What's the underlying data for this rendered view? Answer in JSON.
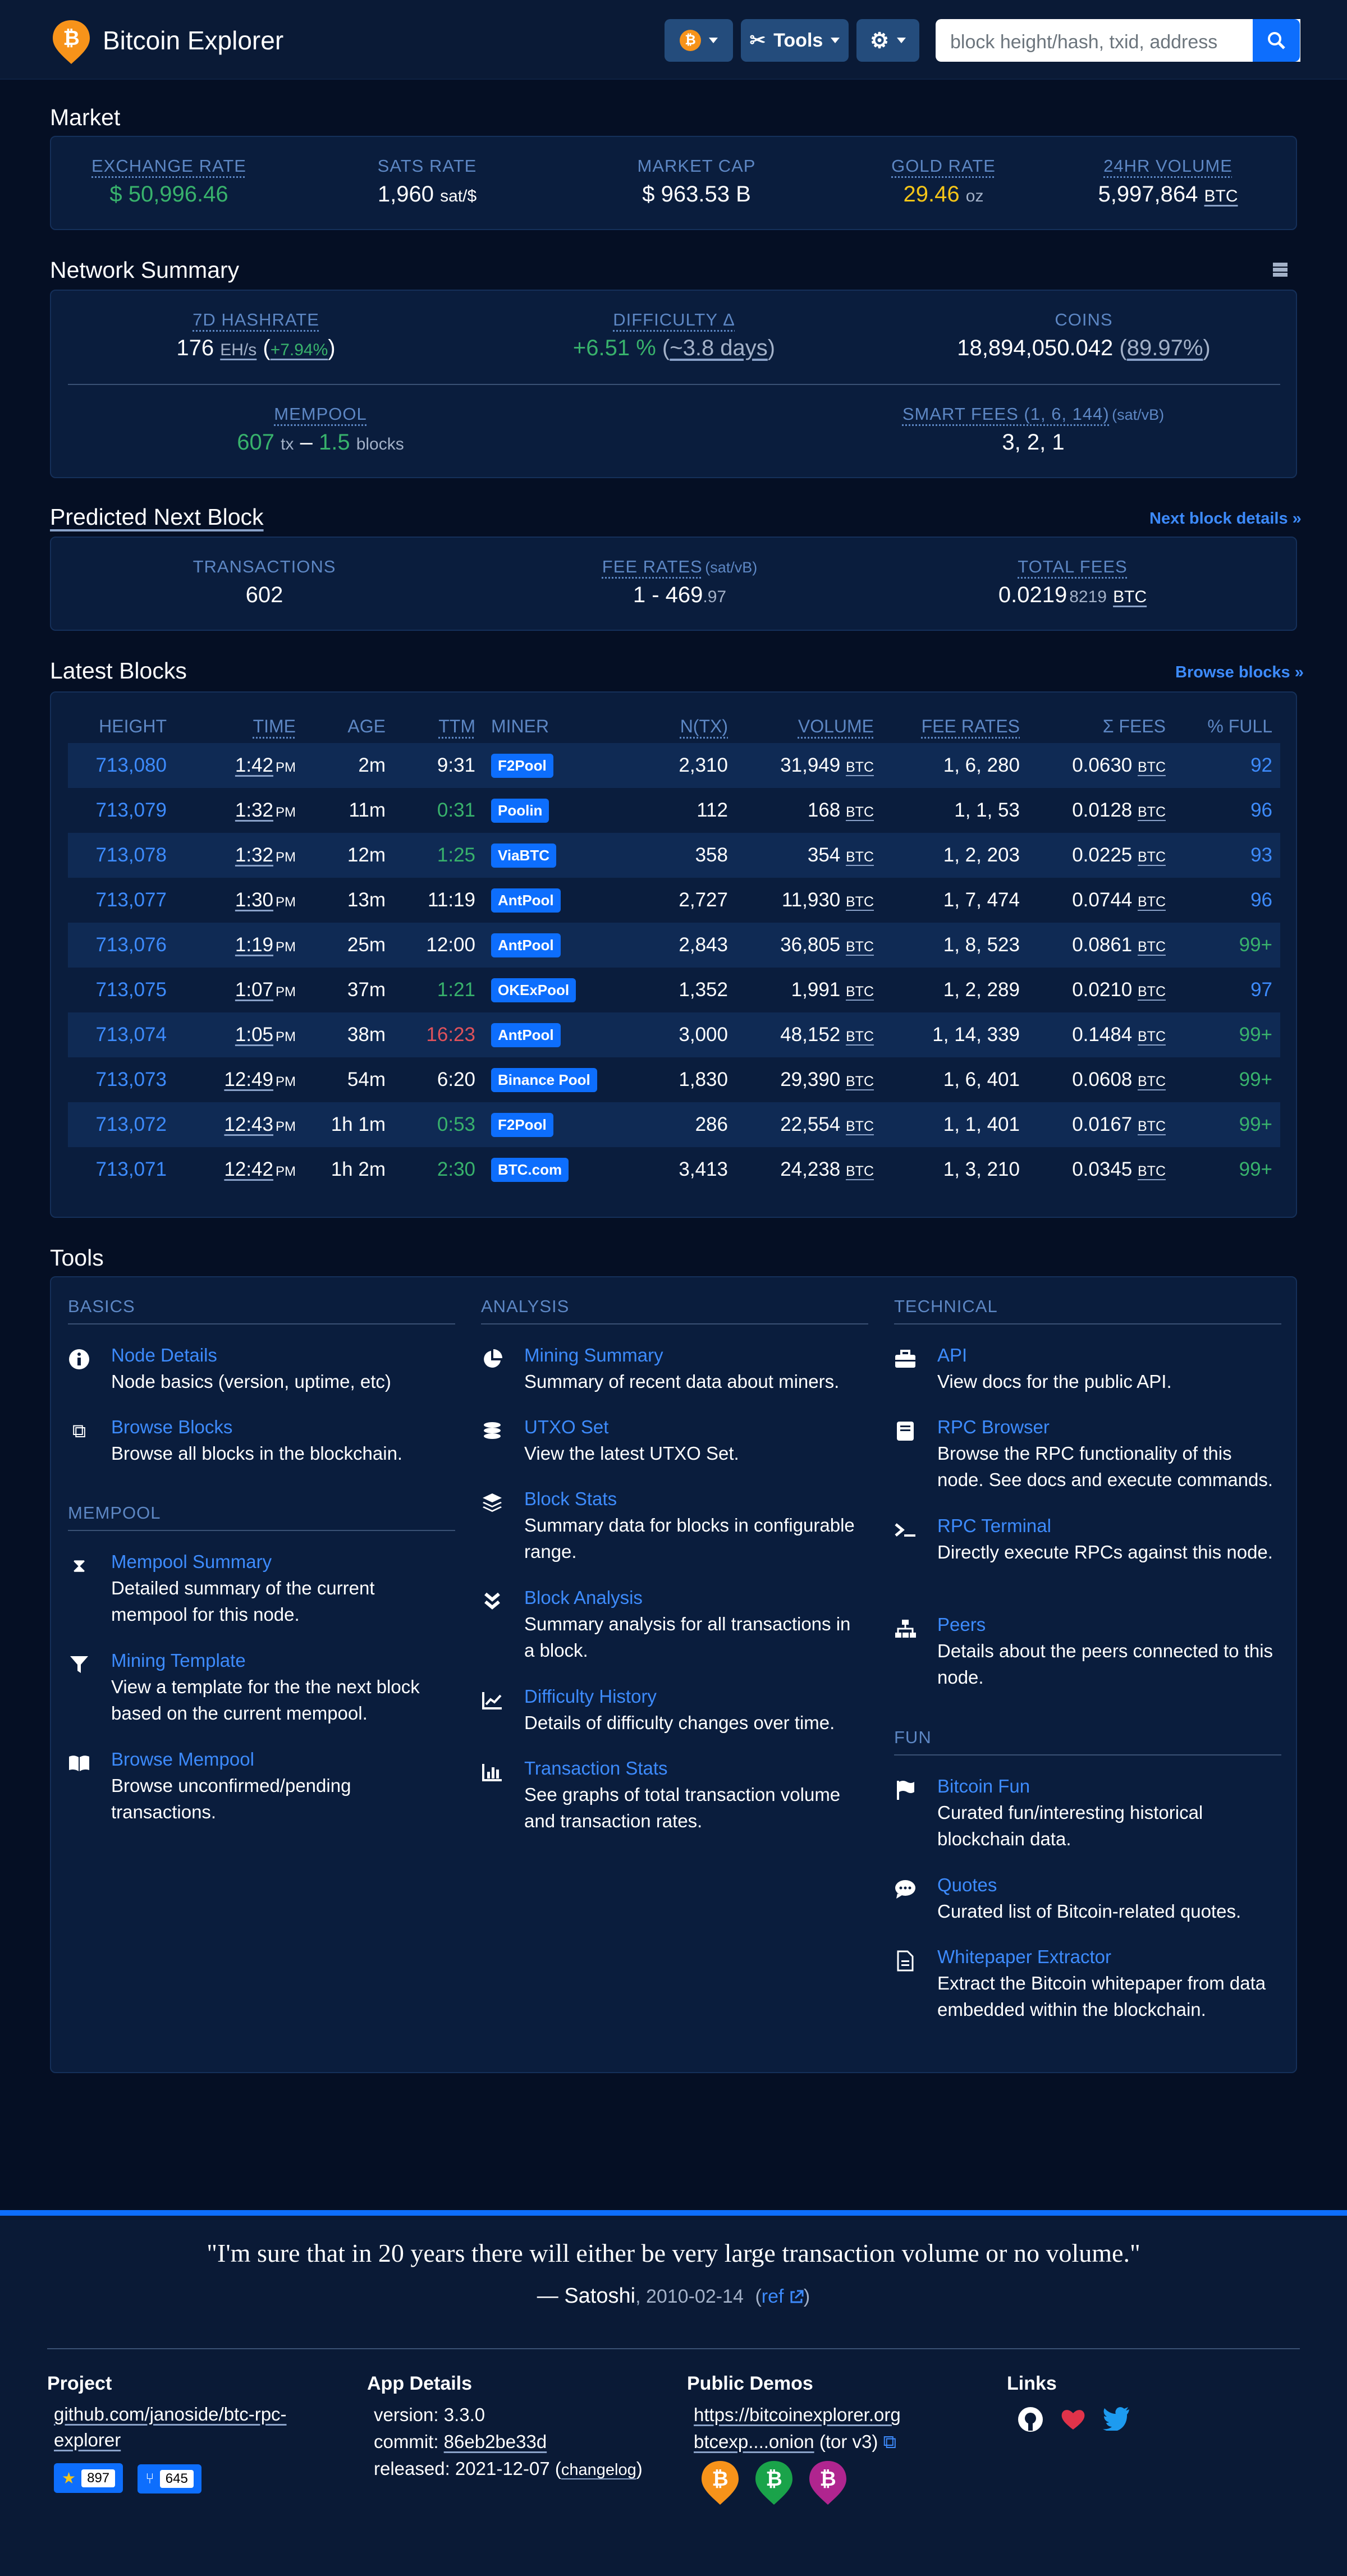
{
  "nav": {
    "brand": "Bitcoin Explorer",
    "tools_label": "Tools",
    "search_placeholder": "block height/hash, txid, address"
  },
  "market": {
    "title": "Market",
    "stats": [
      {
        "label": "EXCHANGE RATE",
        "value": "$ 50,996.46"
      },
      {
        "label": "SATS RATE",
        "value": "1,960",
        "unit": "sat/$"
      },
      {
        "label": "MARKET CAP",
        "value": "$ 963.53 B"
      },
      {
        "label": "GOLD RATE",
        "value": "29.46",
        "unit": "oz"
      },
      {
        "label": "24HR VOLUME",
        "value": "5,997,864",
        "unit": "BTC"
      }
    ]
  },
  "network": {
    "title": "Network Summary",
    "hashrate": {
      "label": "7D HASHRATE",
      "value": "176",
      "unit": "EH/s",
      "change": "+7.94%"
    },
    "difficulty": {
      "label": "DIFFICULTY Δ",
      "value": "+6.51 %",
      "eta": "~3.8 days"
    },
    "coins": {
      "label": "COINS",
      "value": "18,894,050.042",
      "pct": "89.97%"
    },
    "mempool": {
      "label": "MEMPOOL",
      "tx": "607",
      "tx_unit": "tx",
      "dash": "–",
      "blocks": "1.5",
      "blocks_unit": "blocks"
    },
    "smart_fees": {
      "label": "SMART FEES (1, 6, 144)",
      "unit": "(sat/vB)",
      "value": "3, 2, 1"
    }
  },
  "predicted": {
    "title": "Predicted Next Block",
    "link": "Next block details »",
    "transactions": {
      "label": "TRANSACTIONS",
      "value": "602"
    },
    "fee_rates": {
      "label": "FEE RATES",
      "unit": "(sat/vB)",
      "value": "1 - 469",
      "dec": ".97"
    },
    "total_fees": {
      "label": "TOTAL FEES",
      "value": "0.0219",
      "small": "8219",
      "unit": "BTC"
    }
  },
  "latest_blocks": {
    "title": "Latest Blocks",
    "link": "Browse blocks »",
    "columns": [
      "HEIGHT",
      "TIME",
      "AGE",
      "TTM",
      "MINER",
      "N(TX)",
      "VOLUME",
      "FEE RATES",
      "Σ FEES",
      "% FULL"
    ],
    "btc": "BTC",
    "rows": [
      {
        "height": "713,080",
        "time": "1:42",
        "ampm": "PM",
        "age": "2m",
        "ttm": "9:31",
        "ttm_color": "white",
        "miner": "F2Pool",
        "ntx": "2,310",
        "volume": "31,949",
        "fees": "1, 6, 280",
        "sum": "0.0630",
        "full": "92",
        "full_color": "blue"
      },
      {
        "height": "713,079",
        "time": "1:32",
        "ampm": "PM",
        "age": "11m",
        "ttm": "0:31",
        "ttm_color": "green",
        "miner": "Poolin",
        "ntx": "112",
        "volume": "168",
        "fees": "1, 1, 53",
        "sum": "0.0128",
        "full": "96",
        "full_color": "blue"
      },
      {
        "height": "713,078",
        "time": "1:32",
        "ampm": "PM",
        "age": "12m",
        "ttm": "1:25",
        "ttm_color": "green",
        "miner": "ViaBTC",
        "ntx": "358",
        "volume": "354",
        "fees": "1, 2, 203",
        "sum": "0.0225",
        "full": "93",
        "full_color": "blue"
      },
      {
        "height": "713,077",
        "time": "1:30",
        "ampm": "PM",
        "age": "13m",
        "ttm": "11:19",
        "ttm_color": "white",
        "miner": "AntPool",
        "ntx": "2,727",
        "volume": "11,930",
        "fees": "1, 7, 474",
        "sum": "0.0744",
        "full": "96",
        "full_color": "blue"
      },
      {
        "height": "713,076",
        "time": "1:19",
        "ampm": "PM",
        "age": "25m",
        "ttm": "12:00",
        "ttm_color": "white",
        "miner": "AntPool",
        "ntx": "2,843",
        "volume": "36,805",
        "fees": "1, 8, 523",
        "sum": "0.0861",
        "full": "99+",
        "full_color": "green"
      },
      {
        "height": "713,075",
        "time": "1:07",
        "ampm": "PM",
        "age": "37m",
        "ttm": "1:21",
        "ttm_color": "green",
        "miner": "OKExPool",
        "ntx": "1,352",
        "volume": "1,991",
        "fees": "1, 2, 289",
        "sum": "0.0210",
        "full": "97",
        "full_color": "blue"
      },
      {
        "height": "713,074",
        "time": "1:05",
        "ampm": "PM",
        "age": "38m",
        "ttm": "16:23",
        "ttm_color": "red",
        "miner": "AntPool",
        "ntx": "3,000",
        "volume": "48,152",
        "fees": "1, 14, 339",
        "sum": "0.1484",
        "full": "99+",
        "full_color": "green"
      },
      {
        "height": "713,073",
        "time": "12:49",
        "ampm": "PM",
        "age": "54m",
        "ttm": "6:20",
        "ttm_color": "white",
        "miner": "Binance Pool",
        "ntx": "1,830",
        "volume": "29,390",
        "fees": "1, 6, 401",
        "sum": "0.0608",
        "full": "99+",
        "full_color": "green"
      },
      {
        "height": "713,072",
        "time": "12:43",
        "ampm": "PM",
        "age": "1h 1m",
        "ttm": "0:53",
        "ttm_color": "green",
        "miner": "F2Pool",
        "ntx": "286",
        "volume": "22,554",
        "fees": "1, 1, 401",
        "sum": "0.0167",
        "full": "99+",
        "full_color": "green"
      },
      {
        "height": "713,071",
        "time": "12:42",
        "ampm": "PM",
        "age": "1h 2m",
        "ttm": "2:30",
        "ttm_color": "green",
        "miner": "BTC.com",
        "ntx": "3,413",
        "volume": "24,238",
        "fees": "1, 3, 210",
        "sum": "0.0345",
        "full": "99+",
        "full_color": "green"
      }
    ]
  },
  "tools": {
    "title": "Tools",
    "sections": {
      "basics": "BASICS",
      "mempool": "MEMPOOL",
      "analysis": "ANALYSIS",
      "technical": "TECHNICAL",
      "fun": "FUN"
    },
    "items": {
      "node_details": {
        "name": "Node Details",
        "desc": "Node basics (version, uptime, etc)"
      },
      "browse_blocks": {
        "name": "Browse Blocks",
        "desc": "Browse all blocks in the blockchain."
      },
      "mempool_summary": {
        "name": "Mempool Summary",
        "desc": "Detailed summary of the current mempool for this node."
      },
      "mining_template": {
        "name": "Mining Template",
        "desc": "View a template for the the next block based on the current mempool."
      },
      "browse_mempool": {
        "name": "Browse Mempool",
        "desc": "Browse unconfirmed/pending transactions."
      },
      "mining_summary": {
        "name": "Mining Summary",
        "desc": "Summary of recent data about miners."
      },
      "utxo_set": {
        "name": "UTXO Set",
        "desc": "View the latest UTXO Set."
      },
      "block_stats": {
        "name": "Block Stats",
        "desc": "Summary data for blocks in configurable range."
      },
      "block_analysis": {
        "name": "Block Analysis",
        "desc": "Summary analysis for all transactions in a block."
      },
      "difficulty_history": {
        "name": "Difficulty History",
        "desc": "Details of difficulty changes over time."
      },
      "transaction_stats": {
        "name": "Transaction Stats",
        "desc": "See graphs of total transaction volume and transaction rates."
      },
      "api": {
        "name": "API",
        "desc": "View docs for the public API."
      },
      "rpc_browser": {
        "name": "RPC Browser",
        "desc": "Browse the RPC functionality of this node. See docs and execute commands."
      },
      "rpc_terminal": {
        "name": "RPC Terminal",
        "desc": "Directly execute RPCs against this node."
      },
      "peers": {
        "name": "Peers",
        "desc": "Details about the peers connected to this node."
      },
      "bitcoin_fun": {
        "name": "Bitcoin Fun",
        "desc": "Curated fun/interesting historical blockchain data."
      },
      "quotes": {
        "name": "Quotes",
        "desc": "Curated list of Bitcoin-related quotes."
      },
      "whitepaper": {
        "name": "Whitepaper Extractor",
        "desc": "Extract the Bitcoin whitepaper from data embedded within the blockchain."
      }
    }
  },
  "footer": {
    "quote": "\"I'm sure that in 20 years there will either be very large transaction volume or no volume.\"",
    "author_prefix": "— ",
    "author": "Satoshi",
    "date": ", 2010-02-14",
    "ref": "ref",
    "project": {
      "title": "Project",
      "repo1": "github.com/janoside/btc-rpc-",
      "repo2": "explorer",
      "stars": "897",
      "forks": "645"
    },
    "app": {
      "title": "App Details",
      "version": "version: 3.3.0",
      "commit_label": "commit: ",
      "commit": "86eb2be33d",
      "released": "released: 2021-12-07 (",
      "changelog": "changelog",
      "close": ")"
    },
    "demos": {
      "title": "Public Demos",
      "url": "https://bitcoinexplorer.org",
      "onion": "btcexp....onion",
      "onion_note": " (tor v3)"
    },
    "links": {
      "title": "Links"
    }
  }
}
